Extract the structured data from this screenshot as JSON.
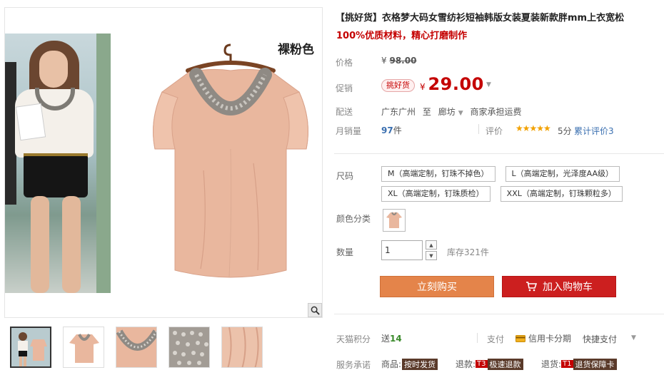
{
  "product": {
    "title": "【挑好货】衣格梦大码女雪纺衫短袖韩版女装夏装新款胖mm上衣宽松",
    "subtitle": "100%优质材料，精心打磨制作",
    "color_tag": "裸粉色"
  },
  "price": {
    "label": "价格",
    "old_symbol": "¥",
    "old_value": "98.00"
  },
  "promo": {
    "label": "促销",
    "badge": "挑好货",
    "symbol": "¥",
    "value": "29.00"
  },
  "shipping": {
    "label": "配送",
    "from": "广东广州",
    "to_word": "至",
    "destination": "廊坊",
    "fee_note": "商家承担运费"
  },
  "sales": {
    "label": "月销量",
    "count": "97",
    "unit": "件",
    "rating_label": "评价",
    "stars": "★★★★★",
    "score": "5分",
    "reviews": "累计评价3"
  },
  "sku": {
    "size_label": "尺码",
    "sizes": [
      "M（高端定制，钉珠不掉色）",
      "L（高端定制，光泽度AA级）",
      "XL（高端定制，钉珠质检）",
      "XXL（高端定制，钉珠颗粒多）"
    ],
    "color_label": "颜色分类",
    "quantity_label": "数量",
    "quantity_value": "1",
    "stock": "库存321件"
  },
  "actions": {
    "buy_now": "立刻购买",
    "add_to_cart": "加入购物车"
  },
  "points": {
    "label": "天猫积分",
    "prefix": "送",
    "value": "14"
  },
  "payment": {
    "label": "支付",
    "card": "信用卡分期",
    "quick": "快捷支付"
  },
  "services": {
    "label": "服务承诺",
    "items": [
      {
        "prefix": "商品:",
        "tag": "按时发货"
      },
      {
        "prefix": "退款:",
        "code": "T3",
        "tag": "极速退款"
      },
      {
        "prefix": "退货:",
        "code": "T1",
        "tag": "退货保障卡"
      }
    ]
  },
  "colors": {
    "price_red": "#c40000",
    "buy_orange": "#e4844a",
    "cart_red": "#cc1f1f",
    "blouse_pink": "#e9b79e",
    "link_blue": "#3a6fb0"
  },
  "icons": {
    "zoom": "magnifier-icon",
    "cart": "cart-icon",
    "card": "credit-card-icon"
  }
}
